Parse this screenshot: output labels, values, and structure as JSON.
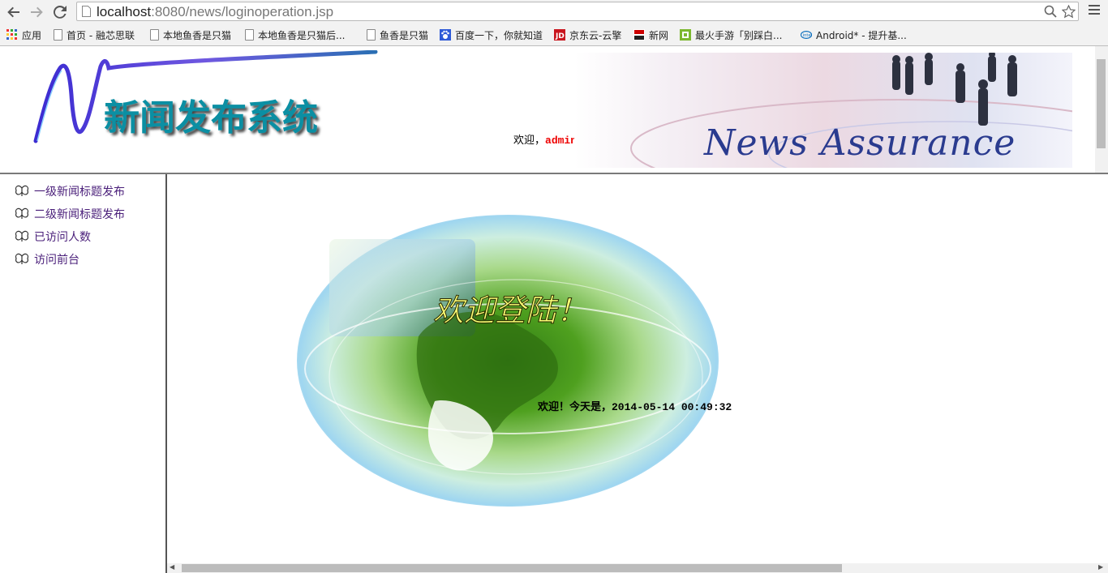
{
  "browser": {
    "url_host": "localhost",
    "url_rest": ":8080/news/loginoperation.jsp",
    "bookmarks": [
      {
        "label": "应用",
        "icon": "apps-grid-icon"
      },
      {
        "label": "首页 - 融芯思联",
        "icon": "page-icon"
      },
      {
        "label": "本地鱼香是只猫",
        "icon": "page-icon"
      },
      {
        "label": "本地鱼香是只猫后...",
        "icon": "page-icon"
      },
      {
        "label": "鱼香是只猫",
        "icon": "page-icon"
      },
      {
        "label": "百度一下，你就知道",
        "icon": "baidu-icon"
      },
      {
        "label": "京东云-云擎",
        "icon": "jd-icon"
      },
      {
        "label": "新网",
        "icon": "xinnet-icon"
      },
      {
        "label": "最火手游「别踩白...",
        "icon": "game-icon"
      },
      {
        "label": "Android* - 提升基...",
        "icon": "intel-icon"
      }
    ]
  },
  "header": {
    "logo_text": "新闻发布系统",
    "banner_text": "News Assurance",
    "welcome_prefix": "欢迎，",
    "username": "admin"
  },
  "sidebar": {
    "items": [
      {
        "label": "一级新闻标题发布"
      },
      {
        "label": "二级新闻标题发布"
      },
      {
        "label": "已访问人数"
      },
      {
        "label": "访问前台"
      }
    ]
  },
  "main": {
    "welcome_big": "欢迎登陆！",
    "date_line": "欢迎！今天是，2014-05-14 00:49:32"
  }
}
